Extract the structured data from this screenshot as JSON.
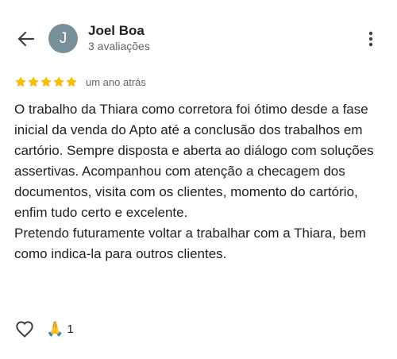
{
  "header": {
    "avatar_letter": "J",
    "avatar_color": "#78909c",
    "name": "Joel Boa",
    "subtitle": "3 avaliações",
    "back_icon": "arrow-back-icon",
    "more_icon": "more-vertical-icon"
  },
  "review": {
    "stars": 5,
    "star_color": "#fbbc04",
    "date": "um ano atrás",
    "paragraphs": [
      "O trabalho da Thiara como corretora foi ótimo desde a fase inicial da venda do Apto até a conclusão dos trabalhos em cartório. Sempre disposta e aberta ao diálogo com soluções assertivas. Acompanhou com atenção a checagem dos documentos, visita com os clientes, momento do cartório, enfim tudo certo e excelente.",
      "Pretendo futuramente voltar a trabalhar com a Thiara, bem como indica-la para outros clientes."
    ]
  },
  "actions": {
    "like_icon": "heart-outline-icon",
    "reaction_emoji": "🙏",
    "reaction_count": "1"
  }
}
